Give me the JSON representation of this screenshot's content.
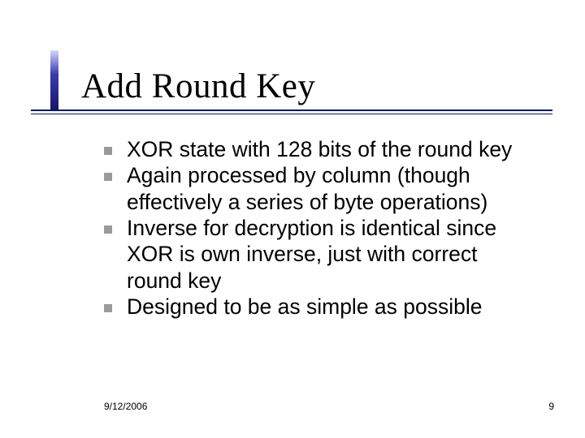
{
  "slide": {
    "title": "Add Round Key",
    "bullets": [
      "XOR state with 128 bits of the round key",
      "Again processed by column (though effectively a series of byte operations)",
      "Inverse for decryption is identical since XOR is own inverse, just with correct round key",
      "Designed to be as simple as possible"
    ]
  },
  "footer": {
    "date": "9/12/2006",
    "page": "9"
  }
}
